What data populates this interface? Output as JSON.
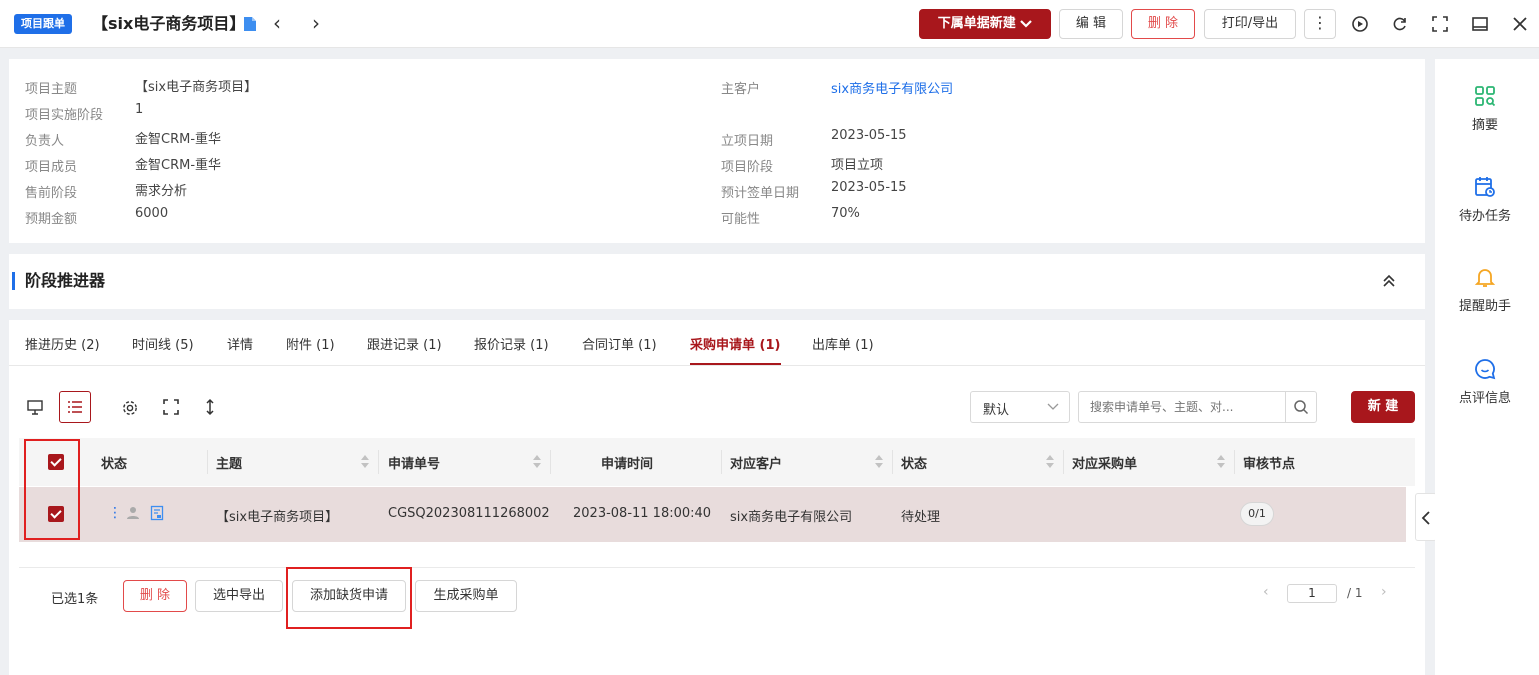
{
  "header": {
    "tag": "项目跟单",
    "title": "【six电子商务项目】",
    "buttons": {
      "create_sub": "下属单据新建",
      "edit": "编 辑",
      "delete": "删 除",
      "print_export": "打印/导出"
    }
  },
  "info": {
    "left": [
      {
        "label": "项目主题",
        "value": "【six电子商务项目】"
      },
      {
        "label": "项目实施阶段",
        "value": "1"
      },
      {
        "label": "负责人",
        "value": "金智CRM-重华"
      },
      {
        "label": "项目成员",
        "value": "金智CRM-重华"
      },
      {
        "label": "售前阶段",
        "value": "需求分析"
      },
      {
        "label": "预期金额",
        "value": "6000"
      }
    ],
    "right": [
      {
        "label": "主客户",
        "value": "six商务电子有限公司"
      },
      {
        "label": "立项日期",
        "value": "2023-05-15"
      },
      {
        "label": "项目阶段",
        "value": "项目立项"
      },
      {
        "label": "预计签单日期",
        "value": "2023-05-15"
      },
      {
        "label": "可能性",
        "value": "70%"
      }
    ]
  },
  "stage_section": {
    "title": "阶段推进器"
  },
  "tabs": [
    {
      "label": "推进历史 (2)"
    },
    {
      "label": "时间线 (5)"
    },
    {
      "label": "详情"
    },
    {
      "label": "附件 (1)"
    },
    {
      "label": "跟进记录 (1)"
    },
    {
      "label": "报价记录 (1)"
    },
    {
      "label": "合同订单 (1)"
    },
    {
      "label": "采购申请单 (1)",
      "active": true
    },
    {
      "label": "出库单 (1)"
    }
  ],
  "toolbar": {
    "sort_select": "默认",
    "search_placeholder": "搜索申请单号、主题、对...",
    "new_button": "新 建"
  },
  "table": {
    "columns": [
      "状态",
      "主题",
      "申请单号",
      "申请时间",
      "对应客户",
      "状态",
      "对应采购单",
      "审核节点"
    ],
    "rows": [
      {
        "subject": "【six电子商务项目】",
        "number": "CGSQ202308111268002",
        "time": "2023-08-11 18:00:40",
        "customer": "six商务电子有限公司",
        "status": "待处理",
        "purchase_order": "",
        "review_node": "0/1"
      }
    ]
  },
  "footer": {
    "selected": "已选1条",
    "delete": "删 除",
    "export_selected": "选中导出",
    "add_shortage": "添加缺货申请",
    "gen_purchase": "生成采购单",
    "page_current": "1",
    "page_total": "/ 1"
  },
  "sidebar": [
    {
      "label": "摘要",
      "icon": "summary-icon",
      "color": "#2bb673"
    },
    {
      "label": "待办任务",
      "icon": "calendar-icon",
      "color": "#1f6fe8"
    },
    {
      "label": "提醒助手",
      "icon": "bell-icon",
      "color": "#f5a623"
    },
    {
      "label": "点评信息",
      "icon": "chat-icon",
      "color": "#1f6fe8"
    }
  ],
  "colors": {
    "brand": "#a8171c",
    "link": "#1f6fe8",
    "row_selected": "#e8dcdc",
    "highlight": "#e02020"
  }
}
